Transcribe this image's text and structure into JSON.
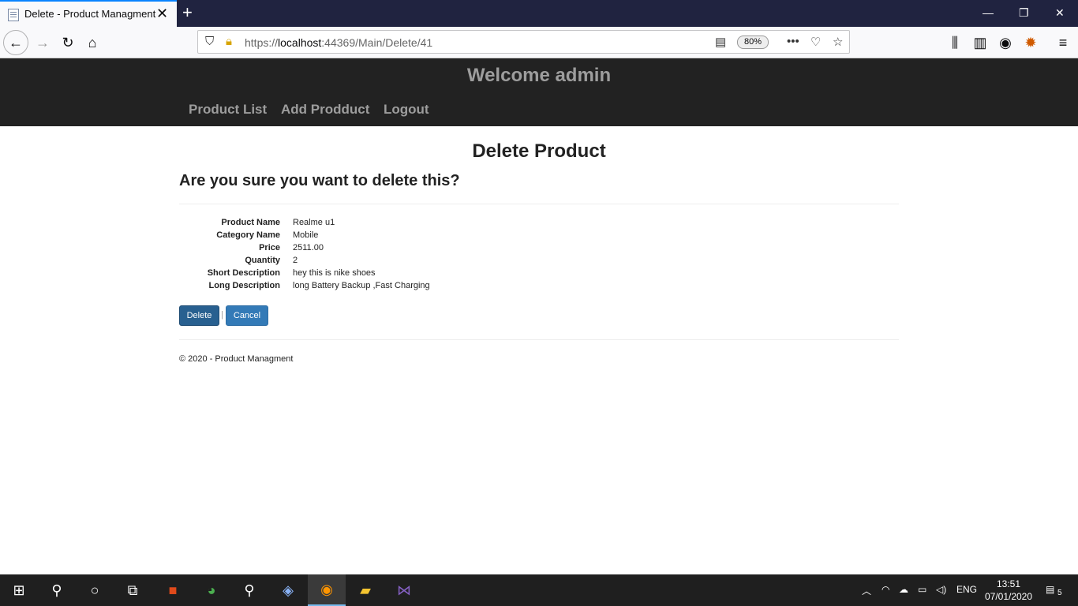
{
  "browser": {
    "tab_title": "Delete - Product Managment",
    "url_prefix": "https://",
    "url_host": "localhost",
    "url_path": ":44369/Main/Delete/41",
    "zoom": "80%"
  },
  "site": {
    "welcome": "Welcome admin",
    "nav": [
      "Product List",
      "Add Prodduct",
      "Logout"
    ]
  },
  "page": {
    "title": "Delete Product",
    "confirm": "Are you sure you want to delete this?",
    "fields": [
      {
        "label": "Product Name",
        "value": "Realme u1"
      },
      {
        "label": "Category Name",
        "value": "Mobile"
      },
      {
        "label": "Price",
        "value": "2511.00"
      },
      {
        "label": "Quantity",
        "value": "2"
      },
      {
        "label": "Short Description",
        "value": "hey this is nike shoes"
      },
      {
        "label": "Long Description",
        "value": "long Battery Backup ,Fast Charging"
      }
    ],
    "delete_label": "Delete",
    "separator": "|",
    "cancel_label": "Cancel",
    "footer": "© 2020 - Product Managment"
  },
  "taskbar": {
    "lang": "ENG",
    "time": "13:51",
    "date": "07/01/2020",
    "notifications": "5"
  },
  "colors": {
    "header_bg": "#222222",
    "nav_text": "#9d9d9d",
    "primary_btn": "#337ab7",
    "tab_accent": "#0a84ff"
  }
}
